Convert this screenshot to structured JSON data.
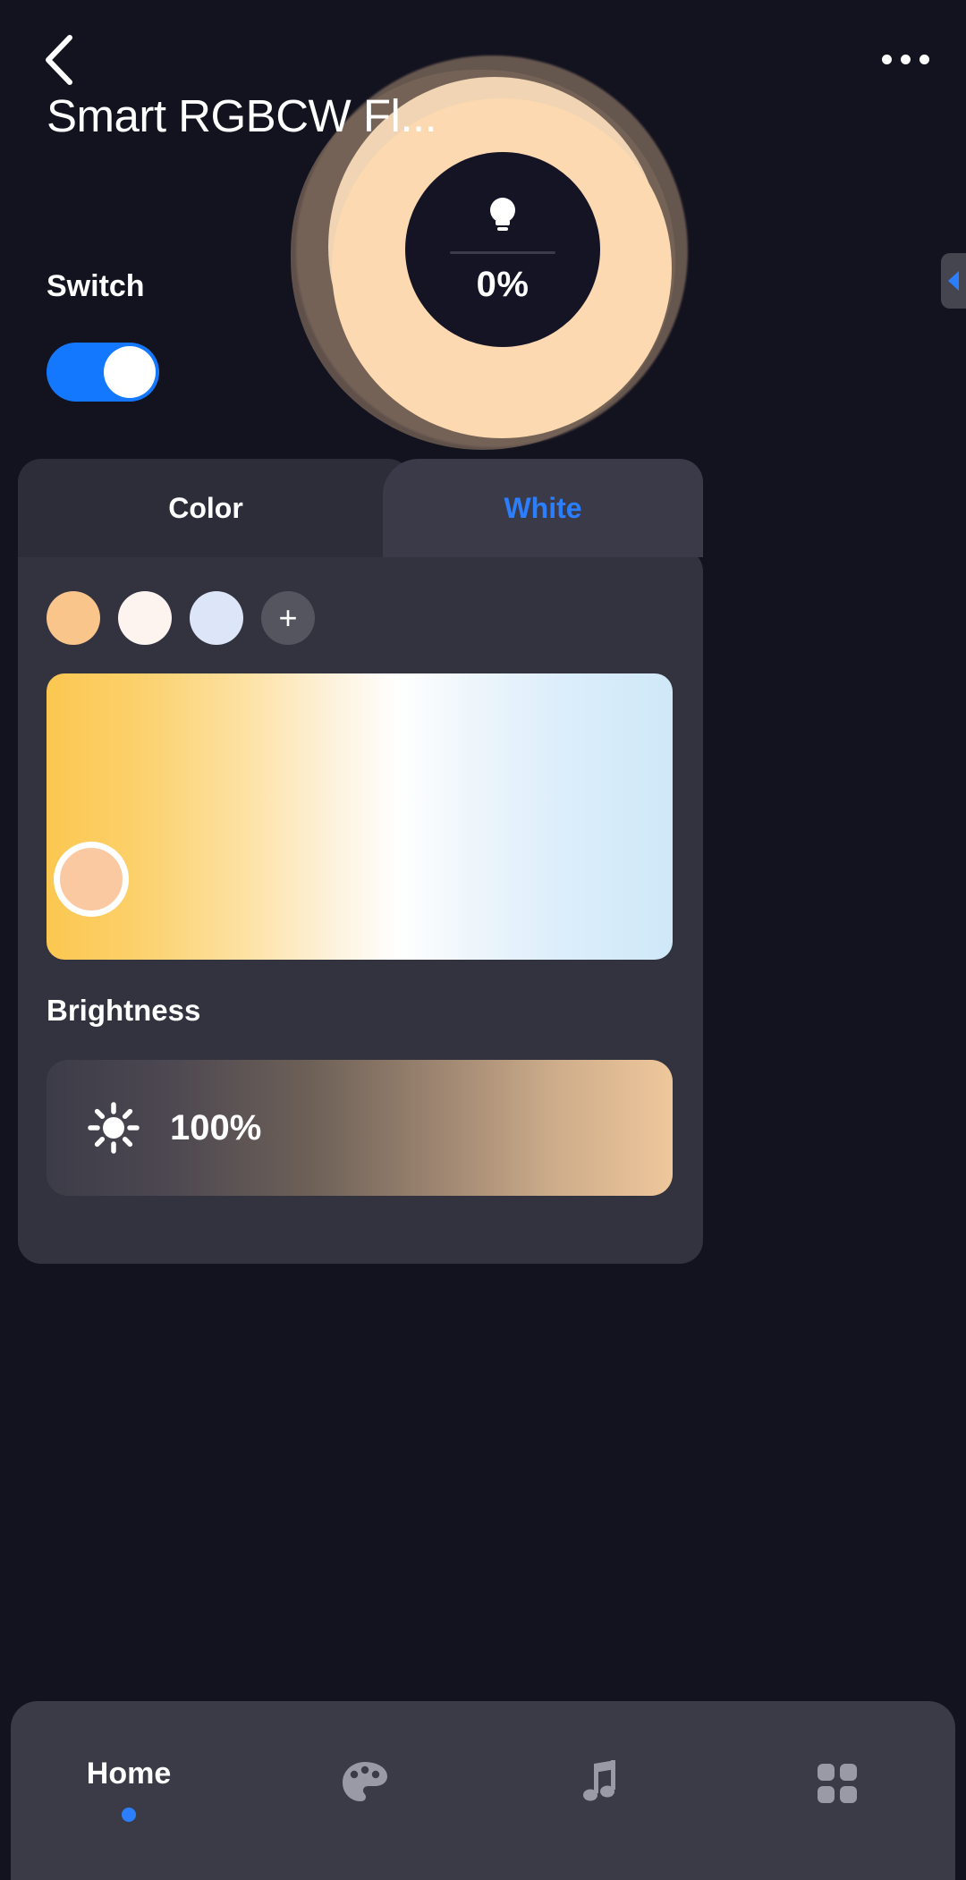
{
  "header": {
    "back_icon": "chevron-left-icon",
    "title": "Smart RGBCW Fl...",
    "more_icon": "more-options-icon"
  },
  "dial": {
    "bulb_icon": "light-bulb-icon",
    "percent": "0%",
    "ring_color": "#fcd9b0",
    "halo_color": "#6e5d53",
    "core_color": "#141425"
  },
  "side_tab": {
    "icon": "chevron-left-icon",
    "accent": "#2b7fff"
  },
  "switch": {
    "label": "Switch",
    "state": "on",
    "track_color": "#1478ff",
    "knob_color": "#ffffff"
  },
  "tabs": [
    {
      "label": "Color",
      "active": false
    },
    {
      "label": "White",
      "active": true
    }
  ],
  "white_panel": {
    "swatches": [
      {
        "name": "warm-peach",
        "color": "#fac58a"
      },
      {
        "name": "warm-white",
        "color": "#fdf4f0"
      },
      {
        "name": "cool-white",
        "color": "#dde6f8"
      }
    ],
    "add_label": "+",
    "temperature_slider": {
      "name": "color-temperature-slider",
      "handle_color": "#fac9a2",
      "handle_position_pct": 2,
      "gradient_from": "#fbc750",
      "gradient_mid": "#ffffff",
      "gradient_to": "#cfe8f8"
    },
    "brightness": {
      "label": "Brightness",
      "icon": "sun-icon",
      "value": "100%",
      "gradient_from": "#3c3c48",
      "gradient_to": "#efc79c"
    }
  },
  "bottom_nav": {
    "items": [
      {
        "label": "Home",
        "icon": "",
        "active": true
      },
      {
        "label": "",
        "icon": "palette-icon",
        "active": false
      },
      {
        "label": "",
        "icon": "music-note-icon",
        "active": false
      },
      {
        "label": "",
        "icon": "grid-icon",
        "active": false
      }
    ],
    "indicator_color": "#2b7fff"
  }
}
